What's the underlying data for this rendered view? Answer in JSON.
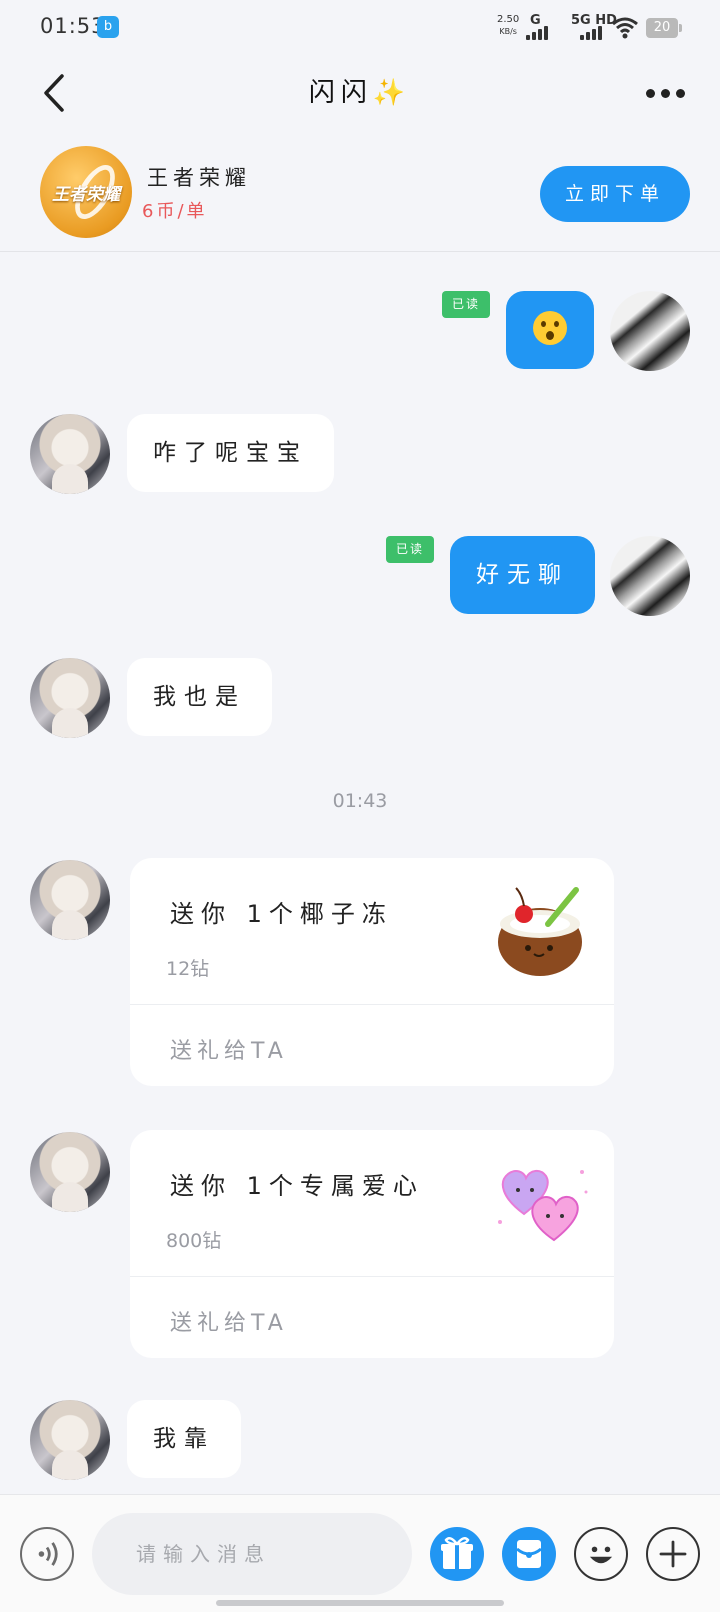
{
  "status_bar": {
    "time": "01:53",
    "net_speed_value": "2.50",
    "net_speed_unit": "KB/s",
    "network_g": "G",
    "network_5g": "5G HD",
    "battery": "20"
  },
  "header": {
    "title": "闪闪✨"
  },
  "game": {
    "name": "王者荣耀",
    "price": "6币/单",
    "order_button": "立即下单",
    "logo_text": "王者荣耀"
  },
  "messages": [
    {
      "side": "out",
      "read_label": "已读",
      "content": "emoji",
      "emoji_icon": "hushed-face-icon"
    },
    {
      "side": "in",
      "text": "咋了呢宝宝"
    },
    {
      "side": "out",
      "read_label": "已读",
      "text": "好无聊"
    },
    {
      "side": "in",
      "text": "我也是"
    }
  ],
  "timestamp": "01:43",
  "gifts": [
    {
      "title": "送你 1个椰子冻",
      "cost": "12钻",
      "send_label": "送礼给TA",
      "image": "coconut-jelly-icon"
    },
    {
      "title": "送你 1个专属爱心",
      "cost": "800钻",
      "send_label": "送礼给TA",
      "image": "hearts-icon"
    }
  ],
  "last_message": {
    "side": "in",
    "text": "我靠"
  },
  "input_bar": {
    "placeholder": "请输入消息"
  },
  "colors": {
    "primary": "#2196f3",
    "read_badge": "#3dbf6a",
    "price": "#e8585a",
    "background": "#f4f5f9"
  }
}
